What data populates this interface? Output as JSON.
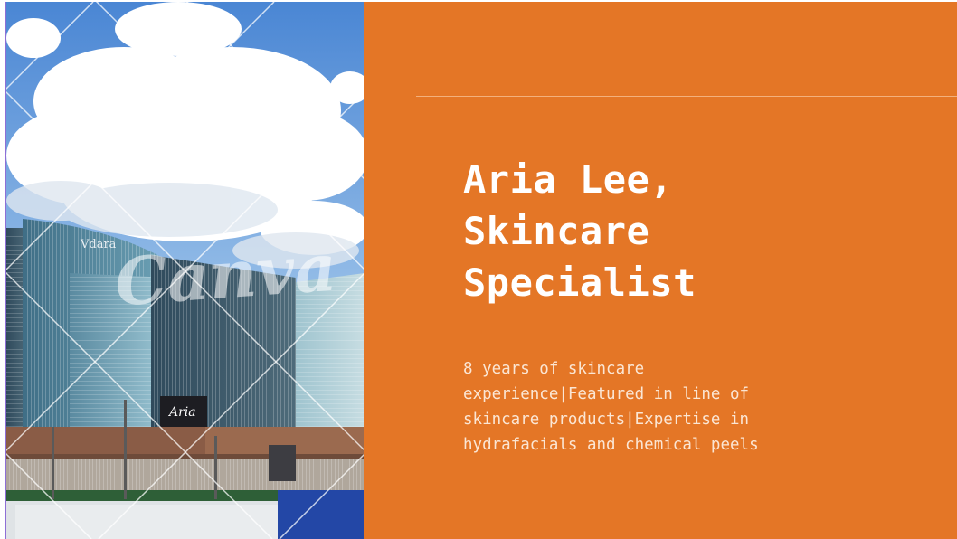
{
  "photo": {
    "description_icon": "building-photo",
    "watermark": "Canva",
    "sign_tower": "Vdara",
    "sign_aria": "Aria"
  },
  "title": {
    "lines": [
      "Aria Lee,",
      "Skincare",
      "Specialist"
    ]
  },
  "description": {
    "lines": [
      "8 years of skincare",
      "experience|Featured in line of",
      "skincare products|Expertise in",
      "hydrafacials and chemical peels"
    ]
  },
  "colors": {
    "panel": "#e47626",
    "title": "#ffffff",
    "body": "#fbe6d4"
  }
}
